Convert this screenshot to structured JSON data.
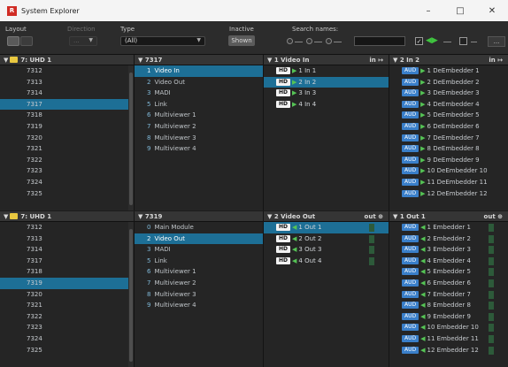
{
  "window": {
    "title": "System Explorer",
    "icon": "R",
    "minimize": "–",
    "maximize": "□",
    "close": "✕"
  },
  "toolbar": {
    "layout_label": "Layout",
    "direction_label": "Direction",
    "direction_value": "...",
    "type_label": "Type",
    "type_value": "(All)",
    "inactive_label": "Inactive",
    "shown_label": "Shown",
    "search_label": "Search names:",
    "check_mark": "✓",
    "more_label": "..."
  },
  "top": {
    "col0": {
      "header": "7: UHD 1",
      "rows": [
        "7312",
        "7313",
        "7314",
        "7317",
        "7318",
        "7319",
        "7320",
        "7321",
        "7322",
        "7323",
        "7324",
        "7325"
      ]
    },
    "col1": {
      "header": "7317",
      "rows": [
        {
          "num": "1",
          "label": "Video In"
        },
        {
          "num": "2",
          "label": "Video Out"
        },
        {
          "num": "3",
          "label": "MADI"
        },
        {
          "num": "5",
          "label": "Link"
        },
        {
          "num": "6",
          "label": "Multiviewer 1"
        },
        {
          "num": "7",
          "label": "Multiviewer 2"
        },
        {
          "num": "8",
          "label": "Multiviewer 3"
        },
        {
          "num": "9",
          "label": "Multiviewer 4"
        }
      ]
    },
    "col2": {
      "header": "1 Video In",
      "right": "in ↦",
      "rows": [
        {
          "badge": "HD",
          "arrow": "▶",
          "label": "1 In 1"
        },
        {
          "badge": "HD",
          "arrow": "▶",
          "label": "2 In 2"
        },
        {
          "badge": "HD",
          "arrow": "▶",
          "label": "3 In 3"
        },
        {
          "badge": "HD",
          "arrow": "▶",
          "label": "4 In 4"
        }
      ]
    },
    "col3": {
      "header": "2 In 2",
      "right": "in ↦",
      "rows": [
        {
          "badge": "AUD",
          "arrow": "▶",
          "label": "1 DeEmbedder 1"
        },
        {
          "badge": "AUD",
          "arrow": "▶",
          "label": "2 DeEmbedder 2"
        },
        {
          "badge": "AUD",
          "arrow": "▶",
          "label": "3 DeEmbedder 3"
        },
        {
          "badge": "AUD",
          "arrow": "▶",
          "label": "4 DeEmbedder 4"
        },
        {
          "badge": "AUD",
          "arrow": "▶",
          "label": "5 DeEmbedder 5"
        },
        {
          "badge": "AUD",
          "arrow": "▶",
          "label": "6 DeEmbedder 6"
        },
        {
          "badge": "AUD",
          "arrow": "▶",
          "label": "7 DeEmbedder 7"
        },
        {
          "badge": "AUD",
          "arrow": "▶",
          "label": "8 DeEmbedder 8"
        },
        {
          "badge": "AUD",
          "arrow": "▶",
          "label": "9 DeEmbedder 9"
        },
        {
          "badge": "AUD",
          "arrow": "▶",
          "label": "10 DeEmbedder 10"
        },
        {
          "badge": "AUD",
          "arrow": "▶",
          "label": "11 DeEmbedder 11"
        },
        {
          "badge": "AUD",
          "arrow": "▶",
          "label": "12 DeEmbedder 12"
        }
      ]
    }
  },
  "bottom": {
    "col0": {
      "header": "7: UHD 1",
      "rows": [
        "7312",
        "7313",
        "7314",
        "7317",
        "7318",
        "7319",
        "7320",
        "7321",
        "7322",
        "7323",
        "7324",
        "7325"
      ]
    },
    "col1": {
      "header": "7319",
      "rows": [
        {
          "num": "0",
          "label": "Main Module"
        },
        {
          "num": "2",
          "label": "Video Out"
        },
        {
          "num": "3",
          "label": "MADI"
        },
        {
          "num": "5",
          "label": "Link"
        },
        {
          "num": "6",
          "label": "Multiviewer 1"
        },
        {
          "num": "7",
          "label": "Multiviewer 2"
        },
        {
          "num": "8",
          "label": "Multiviewer 3"
        },
        {
          "num": "9",
          "label": "Multiviewer 4"
        }
      ]
    },
    "col2": {
      "header": "2 Video Out",
      "right": "out ⊕",
      "rows": [
        {
          "badge": "HD",
          "arrow": "◀",
          "label": "1 Out 1"
        },
        {
          "badge": "HD",
          "arrow": "◀",
          "label": "2 Out 2"
        },
        {
          "badge": "HD",
          "arrow": "◀",
          "label": "3 Out 3"
        },
        {
          "badge": "HD",
          "arrow": "◀",
          "label": "4 Out 4"
        }
      ]
    },
    "col3": {
      "header": "1 Out 1",
      "right": "out ⊕",
      "rows": [
        {
          "badge": "AUD",
          "arrow": "◀",
          "label": "1 Embedder 1"
        },
        {
          "badge": "AUD",
          "arrow": "◀",
          "label": "2 Embedder 2"
        },
        {
          "badge": "AUD",
          "arrow": "◀",
          "label": "3 Embedder 3"
        },
        {
          "badge": "AUD",
          "arrow": "◀",
          "label": "4 Embedder 4"
        },
        {
          "badge": "AUD",
          "arrow": "◀",
          "label": "5 Embedder 5"
        },
        {
          "badge": "AUD",
          "arrow": "◀",
          "label": "6 Embedder 6"
        },
        {
          "badge": "AUD",
          "arrow": "◀",
          "label": "7 Embedder 7"
        },
        {
          "badge": "AUD",
          "arrow": "◀",
          "label": "8 Embedder 8"
        },
        {
          "badge": "AUD",
          "arrow": "◀",
          "label": "9 Embedder 9"
        },
        {
          "badge": "AUD",
          "arrow": "◀",
          "label": "10 Embedder 10"
        },
        {
          "badge": "AUD",
          "arrow": "◀",
          "label": "11 Embedder 11"
        },
        {
          "badge": "AUD",
          "arrow": "◀",
          "label": "12 Embedder 12"
        }
      ]
    }
  },
  "colors": {
    "selection": "#1d6f96",
    "folder": "#e9c840",
    "hd_badge": "#f2f2f2",
    "aud_badge": "#3a7fc9",
    "arrow": "#55c455"
  }
}
